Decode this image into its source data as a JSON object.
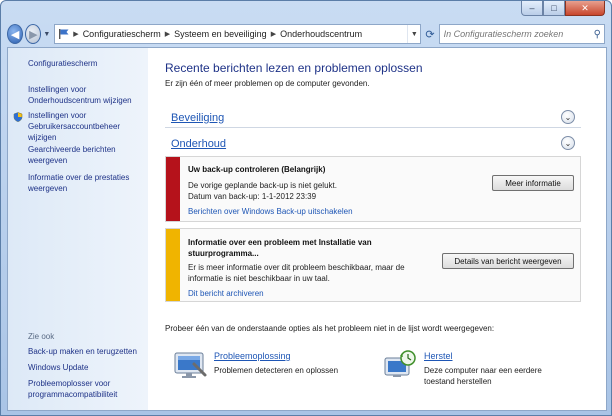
{
  "window": {
    "caption": {
      "minimize": "‒",
      "maximize": "□",
      "close": "✕"
    }
  },
  "address": {
    "crumbs": [
      "Configuratiescherm",
      "Systeem en beveiliging",
      "Onderhoudscentrum"
    ],
    "search_placeholder": "In Configuratiescherm zoeken"
  },
  "sidebar": {
    "home": "Configuratiescherm",
    "items": [
      "Instellingen voor Onderhoudscentrum wijzigen",
      "Instellingen voor Gebruikersaccountbeheer wijzigen",
      "Gearchiveerde berichten weergeven",
      "Informatie over de prestaties weergeven"
    ],
    "see_also": "Zie ook",
    "see_also_items": [
      "Back-up maken en terugzetten",
      "Windows Update",
      "Probleemoplosser voor programmacompatibiliteit"
    ]
  },
  "main": {
    "title": "Recente berichten lezen en problemen oplossen",
    "subtitle": "Er zijn één of meer problemen op de computer gevonden.",
    "sections": {
      "security": "Beveiliging",
      "maintenance": "Onderhoud"
    },
    "messages": [
      {
        "title": "Uw back-up controleren  (Belangrijk)",
        "lines": [
          "De vorige geplande back-up is niet gelukt.",
          "Datum van back-up: 1-1-2012 23:39"
        ],
        "link": "Berichten over Windows Back-up uitschakelen",
        "button": "Meer informatie",
        "color": "#b5121b"
      },
      {
        "title": "Informatie over een probleem met Installatie van stuurprogramma...",
        "lines": [
          "Er is meer informatie over dit probleem beschikbaar, maar de informatie is niet beschikbaar in uw taal."
        ],
        "link": "Dit bericht archiveren",
        "button": "Details van bericht weergeven",
        "color": "#f0b400"
      }
    ],
    "options_intro": "Probeer één van de onderstaande opties als het probleem niet in de lijst wordt weergegeven:",
    "options": [
      {
        "label": "Probleemoplossing",
        "desc": "Problemen detecteren en oplossen",
        "icon": "troubleshoot-icon"
      },
      {
        "label": "Herstel",
        "desc": "Deze computer naar een eerdere toestand herstellen",
        "icon": "restore-icon"
      }
    ]
  }
}
